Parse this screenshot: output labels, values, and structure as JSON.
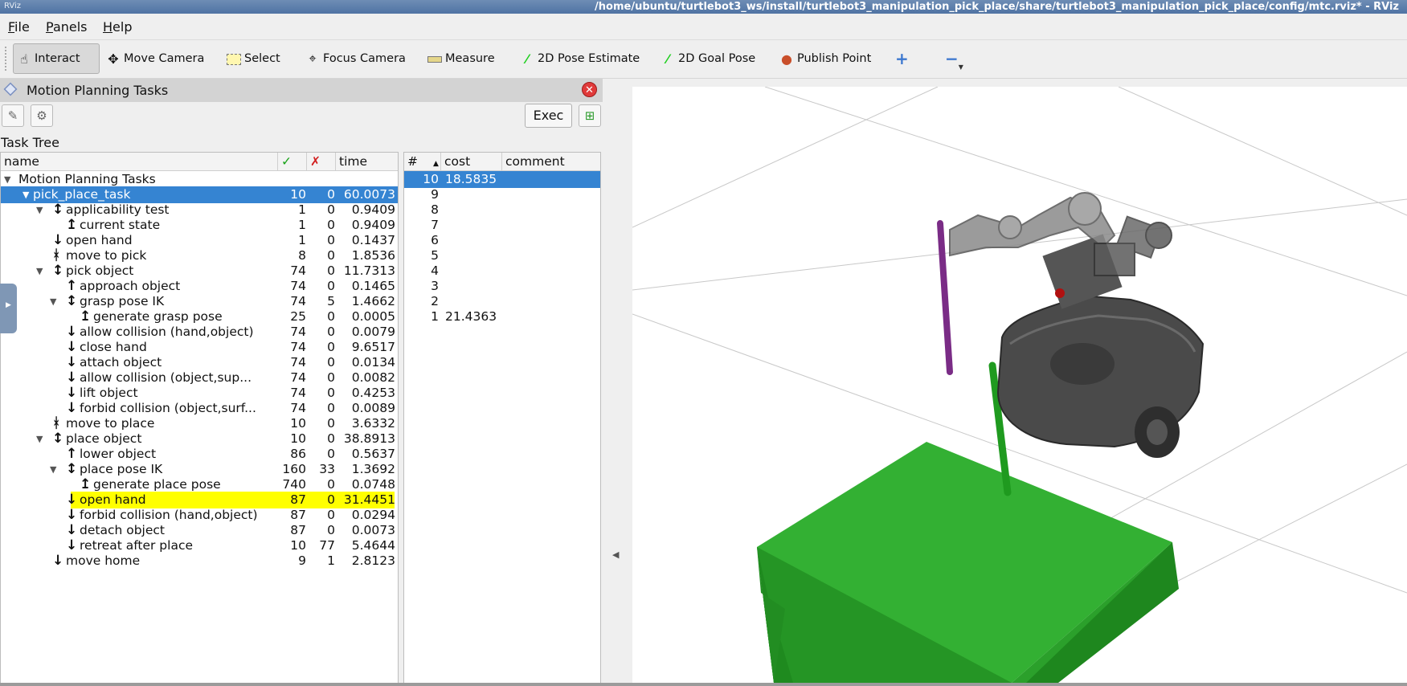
{
  "window": {
    "title": "/home/ubuntu/turtlebot3_ws/install/turtlebot3_manipulation_pick_place/share/turtlebot3_manipulation_pick_place/config/mtc.rviz* - RViz",
    "icon_text": "RViz"
  },
  "menubar": {
    "items": [
      {
        "accel": "F",
        "rest": "ile"
      },
      {
        "accel": "P",
        "rest": "anels"
      },
      {
        "accel": "H",
        "rest": "elp"
      }
    ]
  },
  "toolbar": {
    "interact": "Interact",
    "move_camera": "Move Camera",
    "select": "Select",
    "focus_camera": "Focus Camera",
    "measure": "Measure",
    "pose_estimate": "2D Pose Estimate",
    "goal_pose": "2D Goal Pose",
    "publish_point": "Publish Point",
    "plus": "+",
    "minus": "−",
    "active_tool": "Interact",
    "colors": {
      "green_arrow": "#1fcf1f",
      "pin": "#c94f2a",
      "plus": "#3d78cf"
    }
  },
  "panel": {
    "title": "Motion Planning Tasks",
    "exec_label": "Exec",
    "task_tree_label": "Task Tree"
  },
  "tree": {
    "headers": {
      "name": "name",
      "ok": "✓",
      "fail": "✗",
      "time": "time"
    },
    "rows": [
      {
        "name": "Motion Planning Tasks",
        "ok": "",
        "fail": "",
        "time": "",
        "depth": 0,
        "expand": true,
        "icon": ""
      },
      {
        "name": "pick_place_task",
        "ok": "10",
        "fail": "0",
        "time": "60.0073",
        "depth": 1,
        "expand": true,
        "icon": "",
        "selected": true
      },
      {
        "name": "applicability test",
        "ok": "1",
        "fail": "0",
        "time": "0.9409",
        "depth": 2,
        "expand": true,
        "icon": "↕"
      },
      {
        "name": "current state",
        "ok": "1",
        "fail": "0",
        "time": "0.9409",
        "depth": 3,
        "expand": false,
        "icon": "↥"
      },
      {
        "name": "open hand",
        "ok": "1",
        "fail": "0",
        "time": "0.1437",
        "depth": 2,
        "expand": false,
        "icon": "↓"
      },
      {
        "name": "move to pick",
        "ok": "8",
        "fail": "0",
        "time": "1.8536",
        "depth": 2,
        "expand": false,
        "icon": "ᚼ"
      },
      {
        "name": "pick object",
        "ok": "74",
        "fail": "0",
        "time": "11.7313",
        "depth": 2,
        "expand": true,
        "icon": "↕"
      },
      {
        "name": "approach object",
        "ok": "74",
        "fail": "0",
        "time": "0.1465",
        "depth": 3,
        "expand": false,
        "icon": "↑"
      },
      {
        "name": "grasp pose IK",
        "ok": "74",
        "fail": "5",
        "time": "1.4662",
        "depth": 3,
        "expand": true,
        "icon": "↕"
      },
      {
        "name": "generate grasp pose",
        "ok": "25",
        "fail": "0",
        "time": "0.0005",
        "depth": 4,
        "expand": false,
        "icon": "↥"
      },
      {
        "name": "allow collision (hand,object)",
        "ok": "74",
        "fail": "0",
        "time": "0.0079",
        "depth": 3,
        "expand": false,
        "icon": "↓"
      },
      {
        "name": "close hand",
        "ok": "74",
        "fail": "0",
        "time": "9.6517",
        "depth": 3,
        "expand": false,
        "icon": "↓"
      },
      {
        "name": "attach object",
        "ok": "74",
        "fail": "0",
        "time": "0.0134",
        "depth": 3,
        "expand": false,
        "icon": "↓"
      },
      {
        "name": "allow collision (object,sup...",
        "ok": "74",
        "fail": "0",
        "time": "0.0082",
        "depth": 3,
        "expand": false,
        "icon": "↓"
      },
      {
        "name": "lift object",
        "ok": "74",
        "fail": "0",
        "time": "0.4253",
        "depth": 3,
        "expand": false,
        "icon": "↓"
      },
      {
        "name": "forbid collision (object,surf...",
        "ok": "74",
        "fail": "0",
        "time": "0.0089",
        "depth": 3,
        "expand": false,
        "icon": "↓"
      },
      {
        "name": "move to place",
        "ok": "10",
        "fail": "0",
        "time": "3.6332",
        "depth": 2,
        "expand": false,
        "icon": "ᚼ"
      },
      {
        "name": "place object",
        "ok": "10",
        "fail": "0",
        "time": "38.8913",
        "depth": 2,
        "expand": true,
        "icon": "↕"
      },
      {
        "name": "lower object",
        "ok": "86",
        "fail": "0",
        "time": "0.5637",
        "depth": 3,
        "expand": false,
        "icon": "↑"
      },
      {
        "name": "place pose IK",
        "ok": "160",
        "fail": "33",
        "time": "1.3692",
        "depth": 3,
        "expand": true,
        "icon": "↕"
      },
      {
        "name": "generate place pose",
        "ok": "740",
        "fail": "0",
        "time": "0.0748",
        "depth": 4,
        "expand": false,
        "icon": "↥"
      },
      {
        "name": "open hand",
        "ok": "87",
        "fail": "0",
        "time": "31.4451",
        "depth": 3,
        "expand": false,
        "icon": "↓",
        "highlight": true
      },
      {
        "name": "forbid collision (hand,object)",
        "ok": "87",
        "fail": "0",
        "time": "0.0294",
        "depth": 3,
        "expand": false,
        "icon": "↓"
      },
      {
        "name": "detach object",
        "ok": "87",
        "fail": "0",
        "time": "0.0073",
        "depth": 3,
        "expand": false,
        "icon": "↓"
      },
      {
        "name": "retreat after place",
        "ok": "10",
        "fail": "77",
        "time": "5.4644",
        "depth": 3,
        "expand": false,
        "icon": "↓"
      },
      {
        "name": "move home",
        "ok": "9",
        "fail": "1",
        "time": "2.8123",
        "depth": 2,
        "expand": false,
        "icon": "↓"
      }
    ]
  },
  "solutions": {
    "headers": {
      "num": "#",
      "cost": "cost",
      "comment": "comment"
    },
    "rows": [
      {
        "num": "10",
        "cost": "18.5835",
        "selected": true
      },
      {
        "num": "9",
        "cost": ""
      },
      {
        "num": "8",
        "cost": ""
      },
      {
        "num": "7",
        "cost": ""
      },
      {
        "num": "6",
        "cost": ""
      },
      {
        "num": "5",
        "cost": ""
      },
      {
        "num": "4",
        "cost": ""
      },
      {
        "num": "3",
        "cost": ""
      },
      {
        "num": "2",
        "cost": ""
      },
      {
        "num": "1",
        "cost": "21.4363"
      }
    ]
  },
  "colors": {
    "selection": "#3584d2",
    "highlight": "#ffff00",
    "ok_check": "#1aa31a",
    "fail_cross": "#d22020",
    "table_green": "#2aa52a",
    "robot_gray": "#4a4a4a",
    "object_purple": "#7a2c86",
    "object_green": "#1f9a1f"
  }
}
